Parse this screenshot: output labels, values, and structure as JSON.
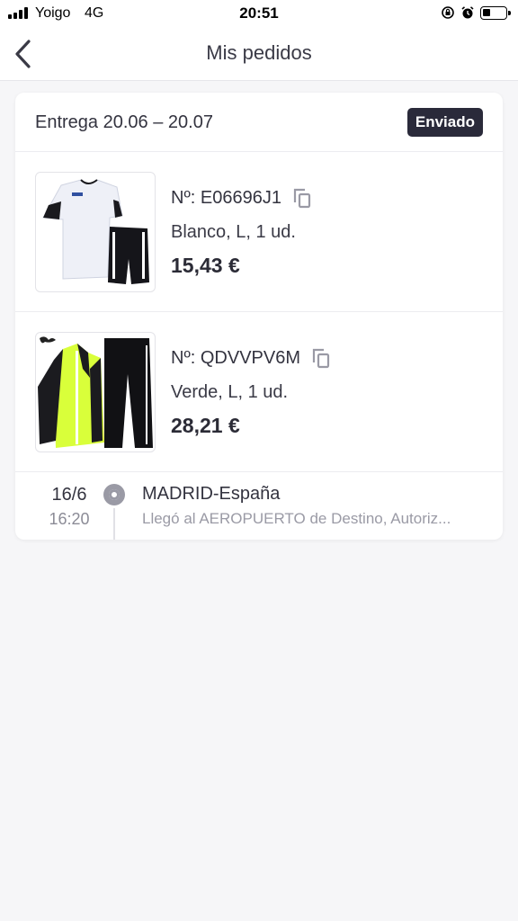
{
  "status_bar": {
    "carrier": "Yoigo",
    "network": "4G",
    "time": "20:51"
  },
  "header": {
    "title": "Mis pedidos",
    "back_icon": "chevron-left-icon"
  },
  "order": {
    "delivery": "Entrega 20.06 – 20.07",
    "status": "Enviado",
    "items": [
      {
        "order_number": "Nº: E06696J1",
        "variant": "Blanco, L, 1 ud.",
        "price": "15,43 €",
        "image": "white-tshirt-black-shorts"
      },
      {
        "order_number": "Nº: QDVVPV6M",
        "variant": "Verde, L, 1 ud.",
        "price": "28,21 €",
        "image": "green-black-tracksuit"
      }
    ],
    "tracking": {
      "date": "16/6",
      "time": "16:20",
      "location": "MADRID-España",
      "detail": "Llegó al AEROPUERTO de Destino, Autoriz..."
    }
  },
  "colors": {
    "badge_bg": "#2a2a3a",
    "background": "#f6f6f8",
    "muted_text": "#9a9aa5"
  }
}
